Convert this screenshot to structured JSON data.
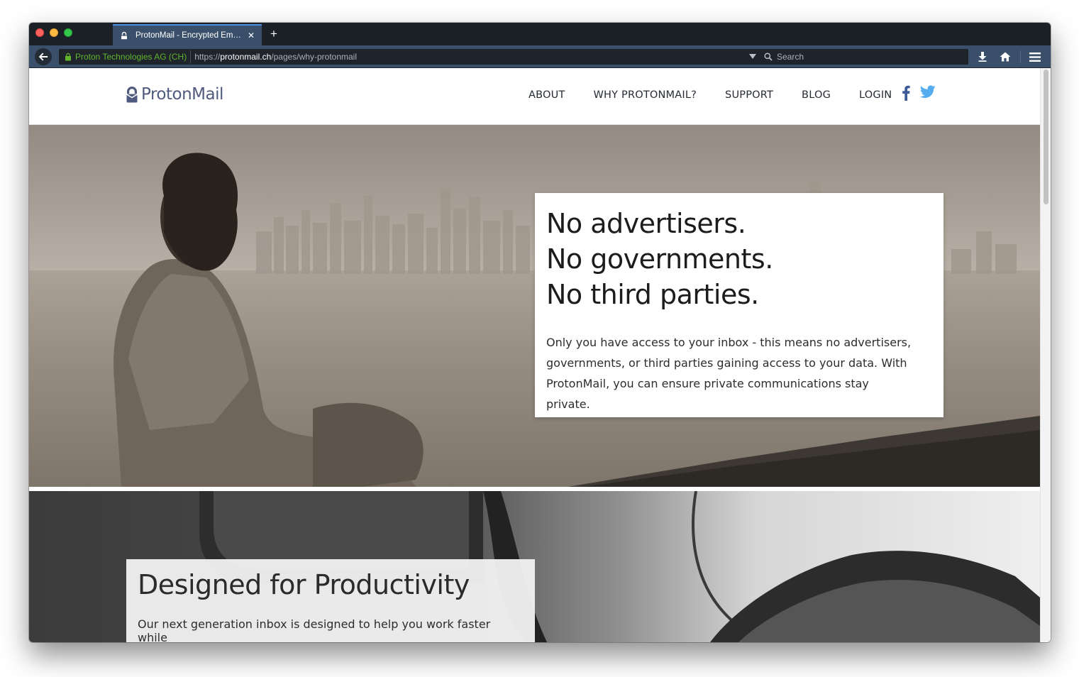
{
  "browser": {
    "tab": {
      "title": "ProtonMail - Encrypted Em…"
    },
    "url": {
      "identity": "Proton Technologies AG (CH)",
      "prefix": "https://",
      "host": "protonmail.ch",
      "path": "/pages/why-protonmail"
    },
    "search_placeholder": "Search"
  },
  "site": {
    "logo": "ProtonMail",
    "nav": [
      "ABOUT",
      "WHY PROTONMAIL?",
      "SUPPORT",
      "BLOG",
      "LOGIN"
    ],
    "social_colors": {
      "facebook": "#3b5998",
      "twitter": "#55acee"
    }
  },
  "hero": {
    "lines": [
      "No advertisers.",
      "No governments.",
      "No third parties."
    ],
    "body": "Only you have access to your inbox - this means no advertisers, governments, or third parties gaining access to your data. With ProtonMail, you can ensure private communications stay private."
  },
  "productivity": {
    "title": "Designed for Productivity",
    "body": "Our next generation inbox is designed to help you work faster while"
  }
}
